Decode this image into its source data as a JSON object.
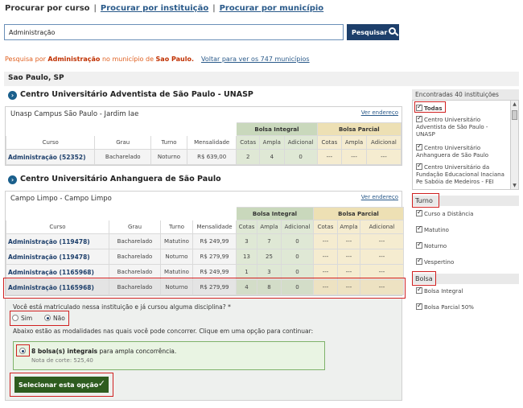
{
  "nav": {
    "current": "Procurar por curso",
    "separator": "|",
    "by_institution": "Procurar por instituição",
    "by_municipality": "Procurar por município"
  },
  "search": {
    "value": "Administração",
    "button_label": "Pesquisar"
  },
  "summary": {
    "prefix": "Pesquisa por ",
    "term": "Administração",
    "middle": " no município de ",
    "city": "Sao Paulo.",
    "back_link": "Voltar para ver os 747 municípios"
  },
  "city_header": "Sao Paulo, SP",
  "columns": {
    "curso": "Curso",
    "grau": "Grau",
    "turno": "Turno",
    "mensalidade": "Mensalidade",
    "bolsa_integral": "Bolsa Integral",
    "bolsa_parcial": "Bolsa Parcial",
    "cotas": "Cotas",
    "ampla": "Ampla",
    "adicional": "Adicional"
  },
  "institutions": [
    {
      "name": "Centro Universitário Adventista de São Paulo - UNASP",
      "campus": "Unasp Campus São Paulo - Jardim Iae",
      "address_link": "Ver endereço",
      "rows": [
        {
          "curso": "Administração (52352)",
          "grau": "Bacharelado",
          "turno": "Noturno",
          "mensalidade": "R$ 639,00",
          "i_cotas": "2",
          "i_ampla": "4",
          "i_adic": "0",
          "p_cotas": "---",
          "p_ampla": "---",
          "p_adic": "---"
        }
      ]
    },
    {
      "name": "Centro Universitário Anhanguera de São Paulo",
      "campus": "Campo Limpo - Campo Limpo",
      "address_link": "Ver endereço",
      "rows": [
        {
          "curso": "Administração (119478)",
          "grau": "Bacharelado",
          "turno": "Matutino",
          "mensalidade": "R$ 249,99",
          "i_cotas": "3",
          "i_ampla": "7",
          "i_adic": "0",
          "p_cotas": "---",
          "p_ampla": "---",
          "p_adic": "---"
        },
        {
          "curso": "Administração (119478)",
          "grau": "Bacharelado",
          "turno": "Noturno",
          "mensalidade": "R$ 279,99",
          "i_cotas": "13",
          "i_ampla": "25",
          "i_adic": "0",
          "p_cotas": "---",
          "p_ampla": "---",
          "p_adic": "---"
        },
        {
          "curso": "Administração (1165968)",
          "grau": "Bacharelado",
          "turno": "Matutino",
          "mensalidade": "R$ 249,99",
          "i_cotas": "1",
          "i_ampla": "3",
          "i_adic": "0",
          "p_cotas": "---",
          "p_ampla": "---",
          "p_adic": "---"
        },
        {
          "curso": "Administração (1165968)",
          "grau": "Bacharelado",
          "turno": "Noturno",
          "mensalidade": "R$ 279,99",
          "i_cotas": "4",
          "i_ampla": "8",
          "i_adic": "0",
          "p_cotas": "---",
          "p_ampla": "---",
          "p_adic": "---"
        }
      ]
    }
  ],
  "question": {
    "text": "Você está matriculado nessa instituição e já cursou alguma disciplina? *",
    "yes": "Sim",
    "no": "Não",
    "selected": "Não",
    "modalities_text": "Abaixo estão as modalidades nas quais você pode concorrer. Clique em uma opção para continuar:",
    "option_bold": "8 bolsa(s) integrais",
    "option_rest": " para ampla concorrência.",
    "option_cut": "Nota de corte: 525,40",
    "select_button": "Selecionar esta opção"
  },
  "sidebar": {
    "found": "Encontradas 40 instituições",
    "institutions": [
      "Todas",
      "Centro Universitário Adventista de São Paulo - UNASP",
      "Centro Universitário Anhanguera de São Paulo",
      "Centro Universitário da Fundação Educacional Inaciana Pe Sabóia de Medeiros - FEI"
    ],
    "turno_label": "Turno",
    "turnos": [
      "Curso a Distância",
      "Matutino",
      "Noturno",
      "Vespertino"
    ],
    "bolsa_label": "Bolsa",
    "bolsas": [
      "Bolsa Integral",
      "Bolsa Parcial 50%"
    ]
  }
}
